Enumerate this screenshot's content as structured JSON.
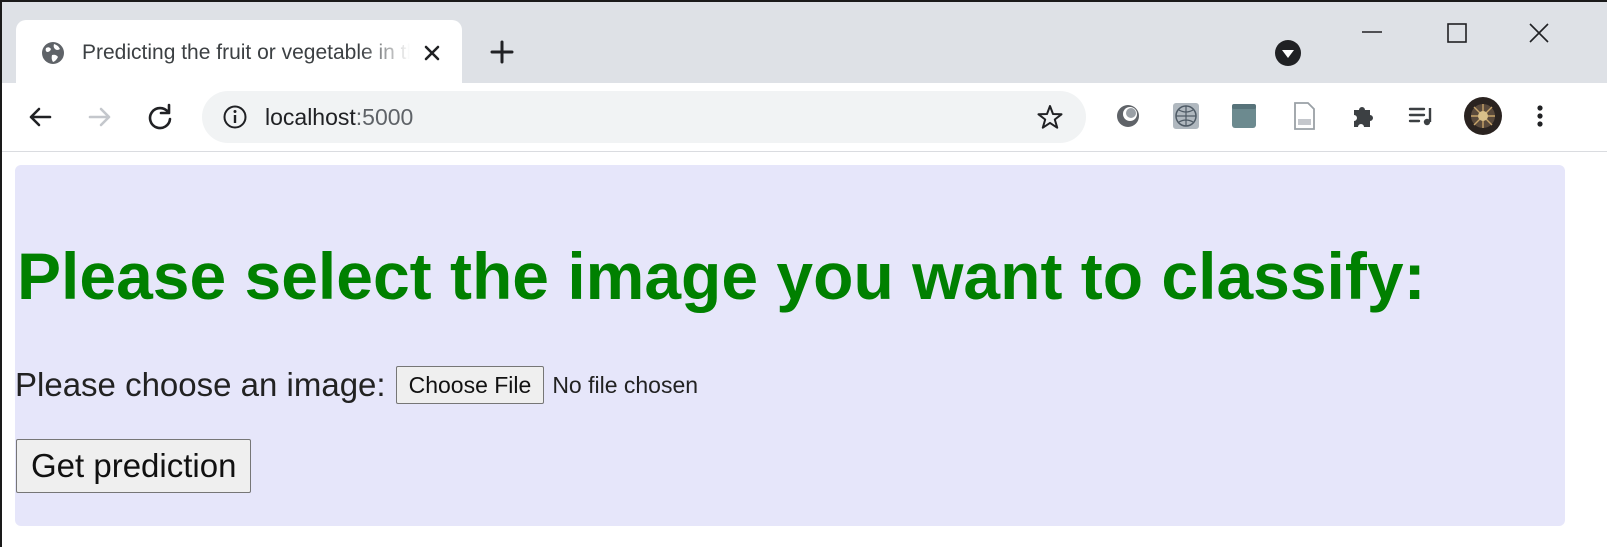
{
  "browser": {
    "tab": {
      "title": "Predicting the fruit or vegetable in the image"
    },
    "address_bar": {
      "host": "localhost",
      "port": ":5000"
    },
    "icons": {
      "favicon": "globe-icon",
      "tab_close": "close-icon",
      "new_tab": "plus-icon",
      "profile_download": "download-arrow-icon",
      "minimize": "minimize-icon",
      "maximize": "maximize-icon",
      "window_close": "close-icon",
      "back": "back-arrow-icon",
      "forward": "forward-arrow-icon",
      "reload": "reload-icon",
      "site_info": "info-icon",
      "bookmark": "star-icon",
      "extensions": [
        "circle-extension-icon",
        "globe-extension-icon",
        "square-extension-icon",
        "document-extension-icon",
        "puzzle-icon",
        "media-playlist-icon",
        "avatar",
        "kebab-menu-icon"
      ]
    }
  },
  "page": {
    "background_color": "#e6e6fa",
    "heading": "Please select the image you want to classify:",
    "heading_color": "#008000",
    "file_input": {
      "label": "Please choose an image:",
      "button_label": "Choose File",
      "status": "No file chosen"
    },
    "submit_button": "Get prediction"
  }
}
